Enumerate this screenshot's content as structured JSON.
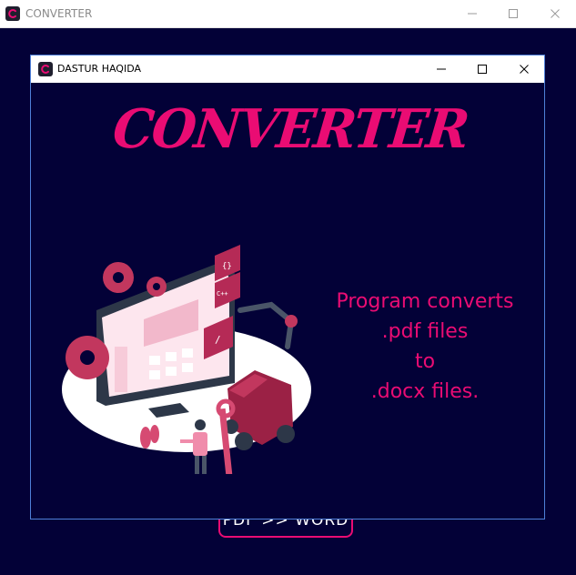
{
  "main_window": {
    "title": "CONVERTER",
    "button_label": "PDF >> WORD"
  },
  "dialog": {
    "title": "DASTUR HAQIDA",
    "headline": "CONVERTER",
    "description_lines": [
      "Program converts",
      ".pdf files",
      "to",
      ".docx files."
    ]
  },
  "window_controls": [
    "minimize-icon",
    "maximize-icon",
    "close-icon"
  ],
  "colors": {
    "accent": "#ea0c73",
    "background": "#030137",
    "titlebar": "#ffffff"
  }
}
